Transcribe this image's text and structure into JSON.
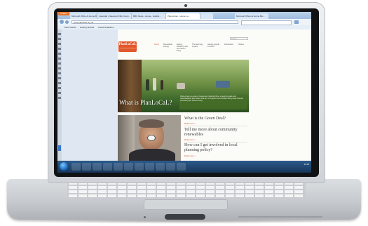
{
  "browser": {
    "app_button_label": "Firefox",
    "tabs": [
      {
        "label": "Microsoft Office At Home Blo...",
        "active": false
      },
      {
        "label": "Calendar • Selected Offer Comp...",
        "active": false
      },
      {
        "label": "BBC News - Home - Goldilo...",
        "active": false
      },
      {
        "label": "PlanLoCaL - Home Lo...",
        "active": true
      },
      {
        "label": "",
        "active": false
      },
      {
        "label": "Microsoft Office At Home Blo...",
        "active": false
      }
    ],
    "address": "www.planlocal.org.uk",
    "bookmarks": [
      "Most Visited",
      "Getting Started",
      "Latest Headlines"
    ]
  },
  "site": {
    "logo_text": "PlanLoCaL",
    "logo_tagline": "community low carbon planning",
    "search_placeholder": "Search",
    "nav": [
      {
        "label": "Home",
        "active": true
      },
      {
        "label": "Renewable energy",
        "active": false
      },
      {
        "label": "Energy efficiency and low carbon living",
        "active": false
      },
      {
        "label": "The planning system",
        "active": false
      },
      {
        "label": "Getting people involved",
        "active": false
      },
      {
        "label": "Factsheets",
        "active": false
      },
      {
        "label": "Videos",
        "active": false
      }
    ],
    "hero_title": "What is PlanLoCaL?",
    "hero_caption": "PlanLoCaL is a suite of resources including films, a learning pack and downloadable fact sheets that aim to support communities and groups that are promoting low carbon living.",
    "questions": [
      {
        "title": "What is the Green Deal?",
        "link": "Read more »"
      },
      {
        "title": "Tell me more about community renewables",
        "link": "Read more »"
      },
      {
        "title": "How can I get involved in local planning policy?",
        "link": "Read more »"
      }
    ]
  },
  "taskbar": {
    "clock": "11:33"
  },
  "colors": {
    "brand_orange": "#e2572c",
    "link_orange": "#d9502a",
    "taskbar": "#1d4370"
  }
}
